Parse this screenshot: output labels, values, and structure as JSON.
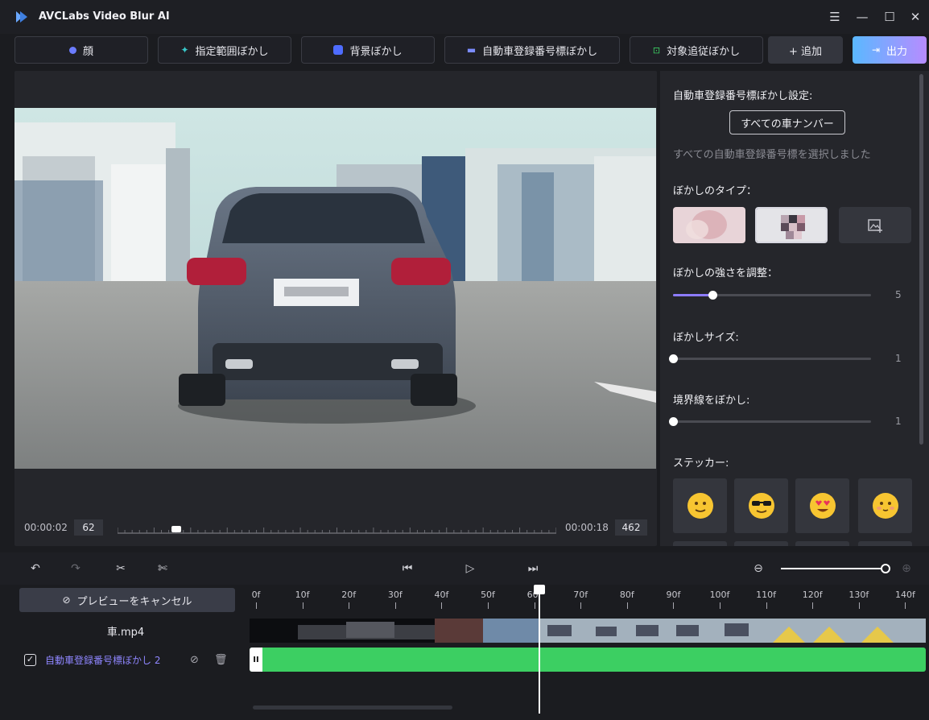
{
  "app": {
    "title": "AVCLabs Video Blur AI"
  },
  "toolbar": {
    "face_label": "顔",
    "range_label": "指定範囲ぼかし",
    "background_label": "背景ぼかし",
    "plate_label": "自動車登録番号標ぼかし",
    "tracking_label": "対象追従ぼかし",
    "add_label": "+ 追加",
    "export_label": "出力"
  },
  "preview": {
    "current_time": "00:00:02",
    "current_frame": "62",
    "end_time": "00:00:18",
    "end_frame": "462",
    "position_fraction": 0.134
  },
  "settings": {
    "heading": "自動車登録番号標ぼかし設定:",
    "all_plates_button": "すべての車ナンバー",
    "selected_note": "すべての自動車登録番号標を選択しました",
    "blur_type_label": "ぼかしのタイプ：",
    "strength_label": "ぼかしの強さを調整：",
    "strength_value": "5",
    "strength_fraction": 0.2,
    "size_label": "ぼかしサイズ:",
    "size_value": "1",
    "border_label": "境界線をぼかし:",
    "border_value": "1",
    "sticker_label": "ステッカー:",
    "stickers": [
      "smile-face",
      "sunglasses-face",
      "heart-eyes-face",
      "blush-face"
    ]
  },
  "timeline": {
    "cancel_preview_label": "プレビューをキャンセル",
    "file_name": "車.mp4",
    "track_name": "自動車登録番号標ぼかし 2",
    "ruler": [
      "0f",
      "10f",
      "20f",
      "30f",
      "40f",
      "50f",
      "60f",
      "70f",
      "80f",
      "90f",
      "100f",
      "110f",
      "120f",
      "130f",
      "140f"
    ],
    "playhead_frame": 62
  },
  "colors": {
    "accent": "#8d7cff",
    "track_green": "#3ccf62",
    "export_gradient_start": "#5ab8ff",
    "export_gradient_end": "#b78cff"
  }
}
